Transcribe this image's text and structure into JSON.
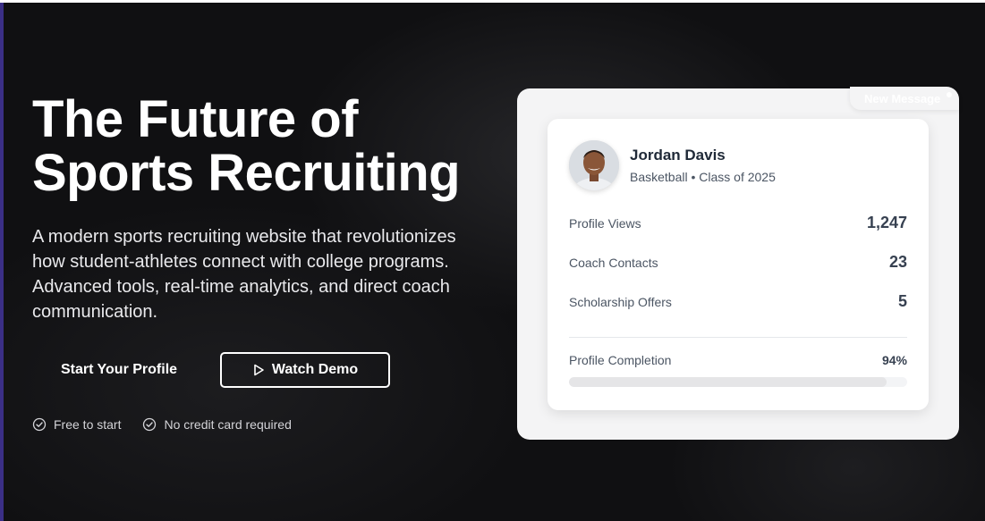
{
  "hero": {
    "title_line1": "The Future of",
    "title_line2": "Sports Recruiting",
    "subtitle": "A modern sports recruiting website that revolutionizes how student-athletes connect with college programs. Advanced tools, real-time analytics, and direct coach communication.",
    "primary_button": "Start Your Profile",
    "secondary_button": "Watch Demo",
    "perks": [
      "Free to start",
      "No credit card required"
    ]
  },
  "badge": {
    "label": "New Message"
  },
  "profile": {
    "name": "Jordan Davis",
    "meta": "Basketball • Class of 2025",
    "stats": [
      {
        "label": "Profile Views",
        "value": "1,247"
      },
      {
        "label": "Coach Contacts",
        "value": "23"
      },
      {
        "label": "Scholarship Offers",
        "value": "5"
      }
    ],
    "completion_label": "Profile Completion",
    "completion_value": "94%",
    "completion_fraction": 0.94
  },
  "icons": {
    "check": "check-circle-icon",
    "play": "play-icon"
  },
  "colors": {
    "background": "#101012",
    "panel": "#f4f4f5",
    "card": "#ffffff",
    "accent_border": "#3b2f86"
  }
}
